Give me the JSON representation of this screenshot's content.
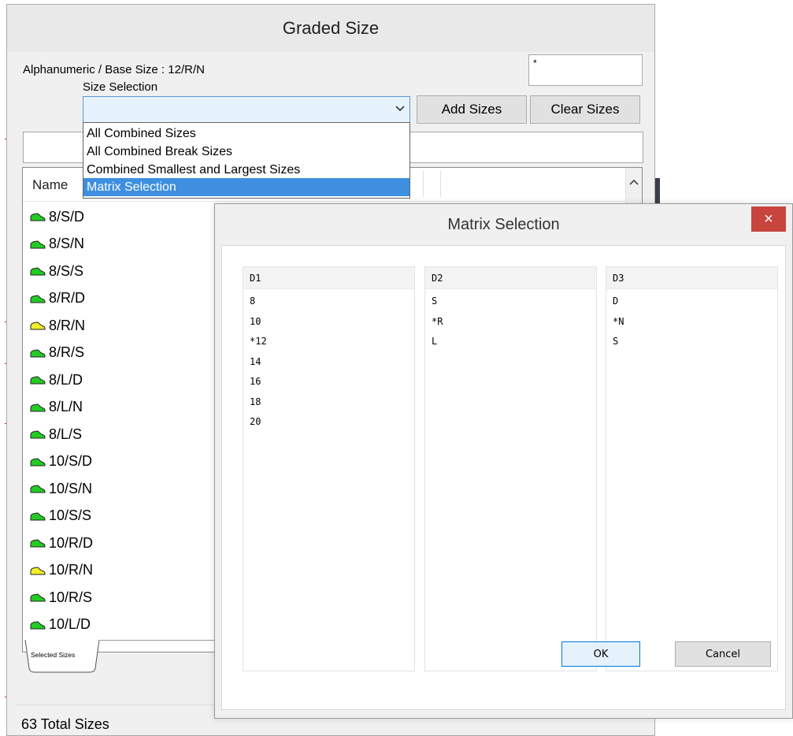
{
  "graded_window": {
    "title": "Graded Size",
    "base_size_label": "Alphanumeric / Base Size : 12/R/N",
    "size_selection_label": "Size Selection",
    "star_input_value": "*",
    "combo_value": "",
    "add_sizes_label": "Add Sizes",
    "clear_sizes_label": "Clear Sizes",
    "filter_input_value": "",
    "list_column_name": "Name",
    "tab_label": "Selected Sizes",
    "total_label": "63 Total Sizes",
    "rows": [
      {
        "label": "8/S/D",
        "status": "green"
      },
      {
        "label": "8/S/N",
        "status": "green"
      },
      {
        "label": "8/S/S",
        "status": "green"
      },
      {
        "label": "8/R/D",
        "status": "green"
      },
      {
        "label": "8/R/N",
        "status": "yellow"
      },
      {
        "label": "8/R/S",
        "status": "green"
      },
      {
        "label": "8/L/D",
        "status": "green"
      },
      {
        "label": "8/L/N",
        "status": "green"
      },
      {
        "label": "8/L/S",
        "status": "green"
      },
      {
        "label": "10/S/D",
        "status": "green"
      },
      {
        "label": "10/S/N",
        "status": "green"
      },
      {
        "label": "10/S/S",
        "status": "green"
      },
      {
        "label": "10/R/D",
        "status": "green"
      },
      {
        "label": "10/R/N",
        "status": "yellow"
      },
      {
        "label": "10/R/S",
        "status": "green"
      },
      {
        "label": "10/L/D",
        "status": "green"
      }
    ]
  },
  "dropdown": {
    "items": [
      {
        "label": "All Combined Sizes",
        "selected": false
      },
      {
        "label": "All Combined Break Sizes",
        "selected": false
      },
      {
        "label": "Combined Smallest and Largest Sizes",
        "selected": false
      },
      {
        "label": "Matrix Selection",
        "selected": true
      }
    ]
  },
  "matrix_dialog": {
    "title": "Matrix Selection",
    "close_glyph": "×",
    "columns": [
      {
        "header": "D1",
        "items": [
          "8",
          "10",
          "*12",
          "14",
          "16",
          "18",
          "20"
        ]
      },
      {
        "header": "D2",
        "items": [
          "S",
          "*R",
          "L"
        ]
      },
      {
        "header": "D3",
        "items": [
          "D",
          "*N",
          "S"
        ]
      }
    ],
    "ok_label": "OK",
    "cancel_label": "Cancel"
  },
  "icons": {
    "status_icon": "shoe-icon",
    "combo_arrow": "chevron-down-icon",
    "scroll_up": "chevron-up-icon",
    "close": "close-icon"
  },
  "colors": {
    "status_green": "#22cc22",
    "status_yellow": "#f2ef2a",
    "selection_blue": "#3e8fe0",
    "close_red": "#c7453d"
  }
}
